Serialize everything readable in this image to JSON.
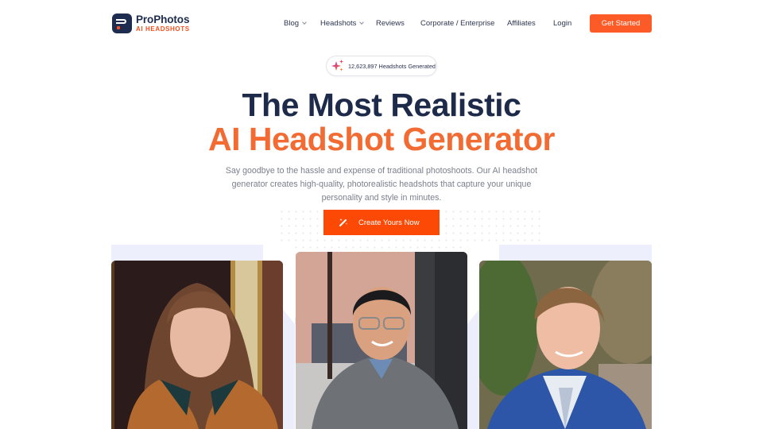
{
  "brand": {
    "name": "ProPhotos",
    "tagline": "AI HEADSHOTS",
    "colors": {
      "navy": "#1e2d4f",
      "orange": "#fc5a26",
      "cta": "#fc4a06",
      "headline_accent": "#f26b33",
      "panel": "#eeeffc"
    }
  },
  "nav": {
    "items": [
      {
        "label": "Blog",
        "has_dropdown": true
      },
      {
        "label": "Headshots",
        "has_dropdown": true
      },
      {
        "label": "Reviews",
        "has_dropdown": false
      },
      {
        "label": "Corporate / Enterprise",
        "has_dropdown": false
      },
      {
        "label": "Affiliates",
        "has_dropdown": false
      },
      {
        "label": "Login",
        "has_dropdown": false
      }
    ],
    "cta_label": "Get Started"
  },
  "hero": {
    "counter": {
      "icon": "sparkles-icon",
      "text": "12,623,897 Headshots Generated"
    },
    "title_line1": "The Most Realistic",
    "title_line2": "AI Headshot Generator",
    "subtitle": "Say goodbye to the hassle and expense of traditional photoshoots. Our AI headshot generator creates high-quality, photorealistic headshots that capture your unique personality and style in minutes.",
    "cta": {
      "icon": "magic-wand-icon",
      "label": "Create Yours Now"
    }
  },
  "gallery": {
    "photos": [
      {
        "alt": "Woman with long brown hair in tan coat headshot"
      },
      {
        "alt": "Man with glasses in grey jacket headshot"
      },
      {
        "alt": "Man in blue suit headshot"
      }
    ]
  }
}
